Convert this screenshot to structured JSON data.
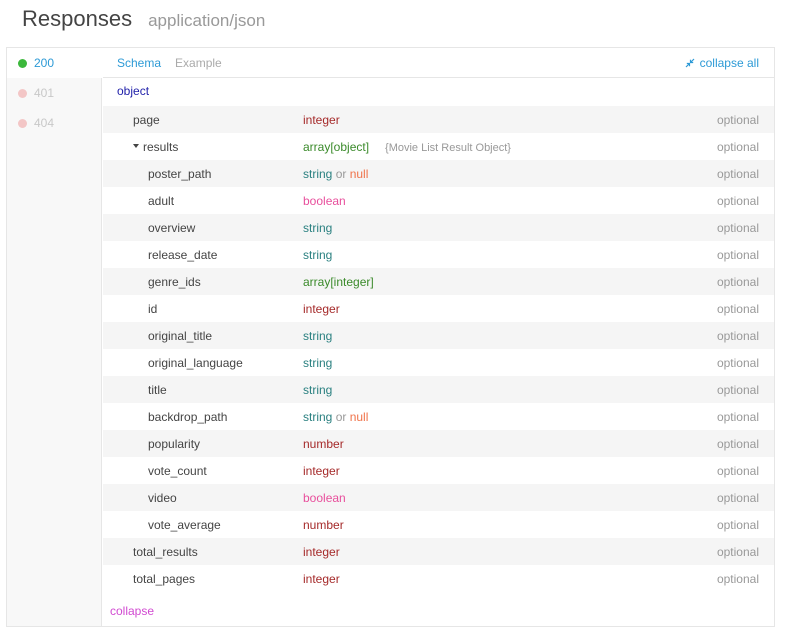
{
  "header": {
    "title": "Responses",
    "subtitle": "application/json"
  },
  "codes": [
    {
      "code": "200",
      "active": true
    },
    {
      "code": "401",
      "active": false
    },
    {
      "code": "404",
      "active": false
    }
  ],
  "tabs": {
    "schema": "Schema",
    "example": "Example"
  },
  "collapse_all": "collapse all",
  "object_label": "object",
  "rows": [
    {
      "name": "page",
      "type": "integer",
      "optional": "optional"
    },
    {
      "name": "results",
      "type": "array[object]",
      "note": "{Movie List Result Object}",
      "optional": "optional"
    },
    {
      "name": "poster_path",
      "type": "string",
      "or": "or",
      "null": "null",
      "optional": "optional"
    },
    {
      "name": "adult",
      "type": "boolean",
      "optional": "optional"
    },
    {
      "name": "overview",
      "type": "string",
      "optional": "optional"
    },
    {
      "name": "release_date",
      "type": "string",
      "optional": "optional"
    },
    {
      "name": "genre_ids",
      "type": "array[integer]",
      "optional": "optional"
    },
    {
      "name": "id",
      "type": "integer",
      "optional": "optional"
    },
    {
      "name": "original_title",
      "type": "string",
      "optional": "optional"
    },
    {
      "name": "original_language",
      "type": "string",
      "optional": "optional"
    },
    {
      "name": "title",
      "type": "string",
      "optional": "optional"
    },
    {
      "name": "backdrop_path",
      "type": "string",
      "or": "or",
      "null": "null",
      "optional": "optional"
    },
    {
      "name": "popularity",
      "type": "number",
      "optional": "optional"
    },
    {
      "name": "vote_count",
      "type": "integer",
      "optional": "optional"
    },
    {
      "name": "video",
      "type": "boolean",
      "optional": "optional"
    },
    {
      "name": "vote_average",
      "type": "number",
      "optional": "optional"
    },
    {
      "name": "total_results",
      "type": "integer",
      "optional": "optional"
    },
    {
      "name": "total_pages",
      "type": "integer",
      "optional": "optional"
    }
  ],
  "collapse_label": "collapse",
  "colors": {
    "accent": "#2d9ad6",
    "status_ok": "#3cb83c",
    "status_error": "#f3c6c6",
    "type_integer": "#a52a2a",
    "type_string": "#2a8080",
    "type_boolean": "#e84f9c",
    "type_array": "#3a8a2a",
    "type_null": "#f0734a",
    "collapse": "#d14ad1"
  }
}
